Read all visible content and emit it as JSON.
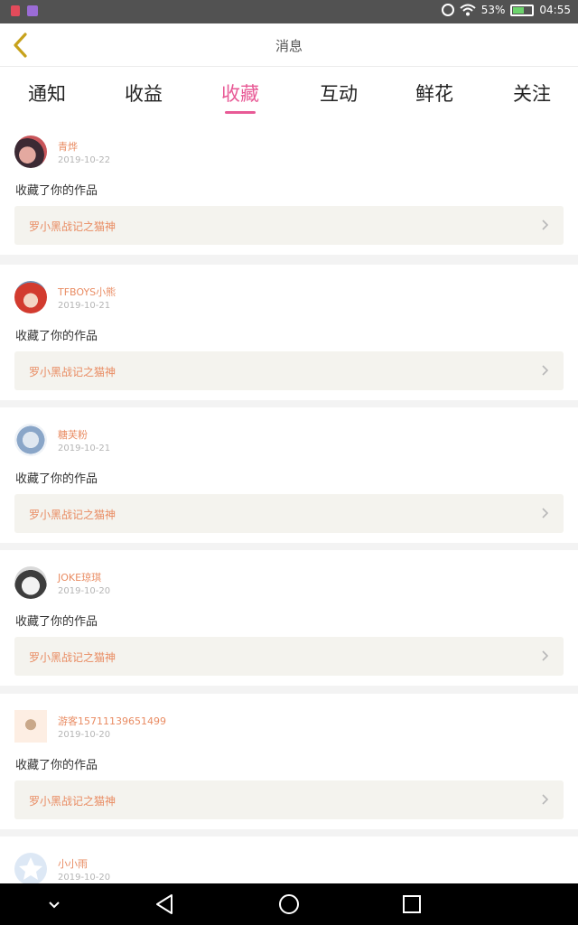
{
  "status_bar": {
    "battery": "53%",
    "battery_level": 0.53,
    "time": "04:55",
    "icons": [
      "alarm-icon",
      "wifi-icon",
      "battery-icon"
    ]
  },
  "header": {
    "title": "消息",
    "back_icon": "chevron-left-icon",
    "back_color": "#c7a21c"
  },
  "tabs": [
    {
      "label": "通知"
    },
    {
      "label": "收益"
    },
    {
      "label": "收藏",
      "active": true
    },
    {
      "label": "互动"
    },
    {
      "label": "鲜花"
    },
    {
      "label": "关注"
    }
  ],
  "accent_color": "#e85a96",
  "name_color": "#e98c63",
  "items": [
    {
      "user": "青烨",
      "date": "2019-10-22",
      "action": "收藏了你的作品",
      "work": "罗小黑战记之猫神"
    },
    {
      "user": "TFBOYS小熊",
      "date": "2019-10-21",
      "action": "收藏了你的作品",
      "work": "罗小黑战记之猫神"
    },
    {
      "user": "糖芙粉",
      "date": "2019-10-21",
      "action": "收藏了你的作品",
      "work": "罗小黑战记之猫神"
    },
    {
      "user": "JOKE琼琪",
      "date": "2019-10-20",
      "action": "收藏了你的作品",
      "work": "罗小黑战记之猫神"
    },
    {
      "user": "游客15711139651499",
      "date": "2019-10-20",
      "action": "收藏了你的作品",
      "work": "罗小黑战记之猫神"
    },
    {
      "user": "小小雨",
      "date": "2019-10-20",
      "action": "",
      "work": ""
    }
  ],
  "navbar": {
    "icons": [
      "chevron-down-icon",
      "back-triangle-icon",
      "home-circle-icon",
      "recents-square-icon"
    ]
  }
}
